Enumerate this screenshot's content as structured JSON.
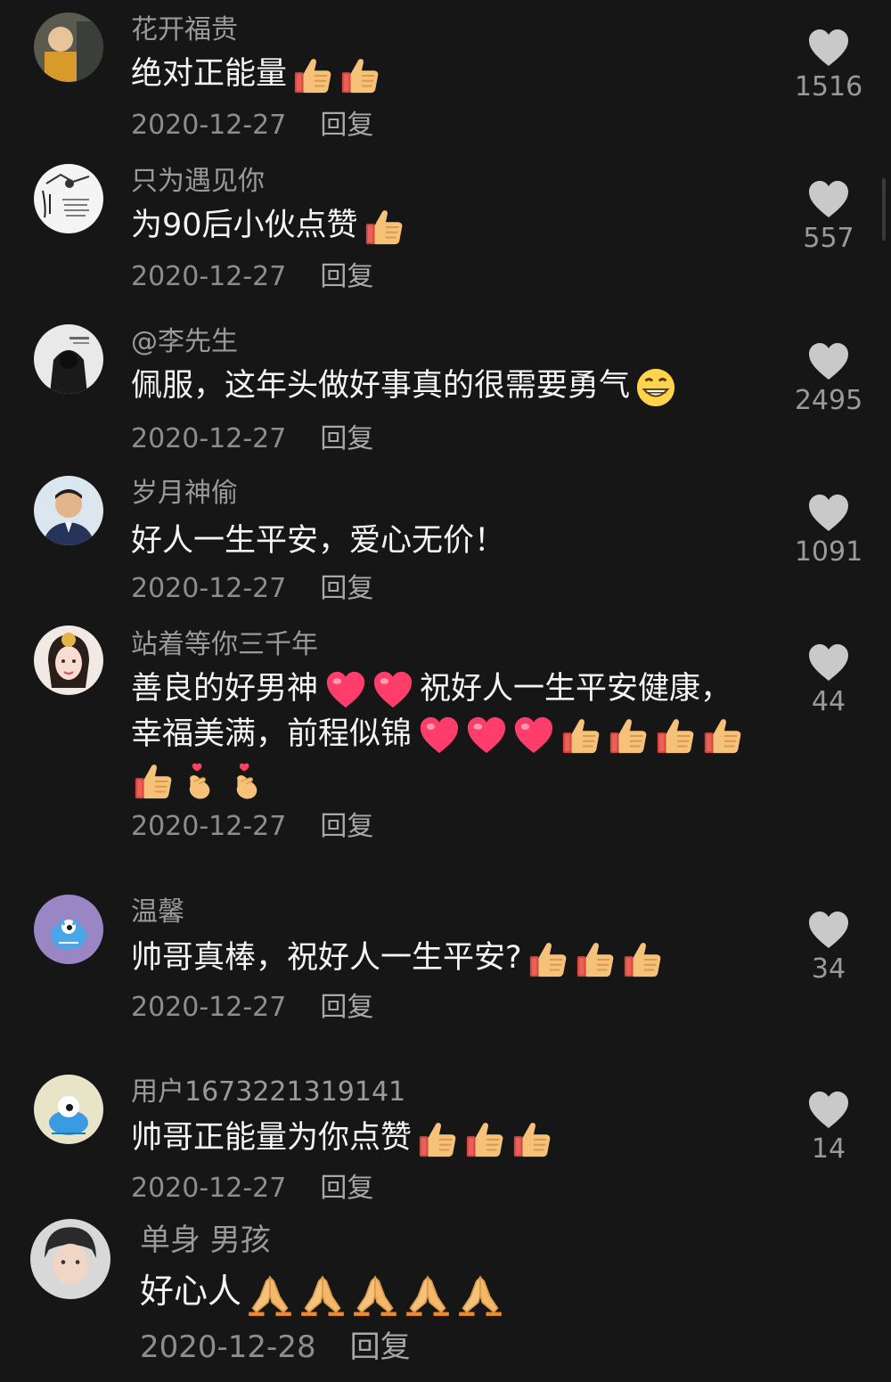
{
  "comments": [
    {
      "username": "花开福贵",
      "text": "绝对正能量",
      "emojis": [
        "thumbs-up",
        "thumbs-up"
      ],
      "date": "2020-12-27",
      "reply": "回复",
      "likes": "1516",
      "avatar": "avatar-child-photo"
    },
    {
      "username": "只为遇见你",
      "text": "为90后小伙点赞",
      "emojis": [
        "thumbs-up"
      ],
      "date": "2020-12-27",
      "reply": "回复",
      "likes": "557",
      "avatar": "avatar-sketch-text"
    },
    {
      "username": "@李先生",
      "text": "佩服，这年头做好事真的很需要勇气",
      "emojis": [
        "grin"
      ],
      "date": "2020-12-27",
      "reply": "回复",
      "likes": "2495",
      "avatar": "avatar-hooded-figure"
    },
    {
      "username": "岁月神偷",
      "text": "好人一生平安，爱心无价！",
      "emojis": [],
      "date": "2020-12-27",
      "reply": "回复",
      "likes": "1091",
      "avatar": "avatar-man-portrait"
    },
    {
      "username": "站着等你三千年",
      "text": "善良的好男神 ❤❤祝好人一生平安健康，幸福美满，前程似锦",
      "text_line1": "善良的好男神",
      "text_line1_tail": "祝好人一生平安健康，",
      "text_line2": "幸福美满，前程似锦",
      "emojis_line1": [
        "heart",
        "heart"
      ],
      "emojis_line2": [
        "heart",
        "heart",
        "heart",
        "thumbs-up",
        "thumbs-up",
        "thumbs-up",
        "thumbs-up"
      ],
      "emojis_line3": [
        "thumbs-up",
        "finger-heart",
        "finger-heart"
      ],
      "date": "2020-12-27",
      "reply": "回复",
      "likes": "44",
      "avatar": "avatar-woman-portrait"
    },
    {
      "username": "温馨",
      "text": "帅哥真棒，祝好人一生平安?",
      "emojis": [
        "thumbs-up",
        "thumbs-up",
        "thumbs-up"
      ],
      "date": "2020-12-27",
      "reply": "回复",
      "likes": "34",
      "avatar": "avatar-blue-monster"
    },
    {
      "username": "用户1673221319141",
      "text": "帅哥正能量为你点赞",
      "emojis": [
        "thumbs-up",
        "thumbs-up",
        "thumbs-up"
      ],
      "date": "2020-12-27",
      "reply": "回复",
      "likes": "14",
      "avatar": "avatar-blue-monster"
    },
    {
      "username": "单身 男孩",
      "text": "好心人",
      "emojis": [
        "pray",
        "pray",
        "pray",
        "pray",
        "pray"
      ],
      "date": "2020-12-28",
      "reply": "回复",
      "likes": "",
      "avatar": "avatar-boy-portrait"
    }
  ],
  "colors": {
    "background": "#161616",
    "text": "#f4f4f4",
    "muted": "#9a9a9a",
    "heart_icon": "#c8c8c8"
  }
}
